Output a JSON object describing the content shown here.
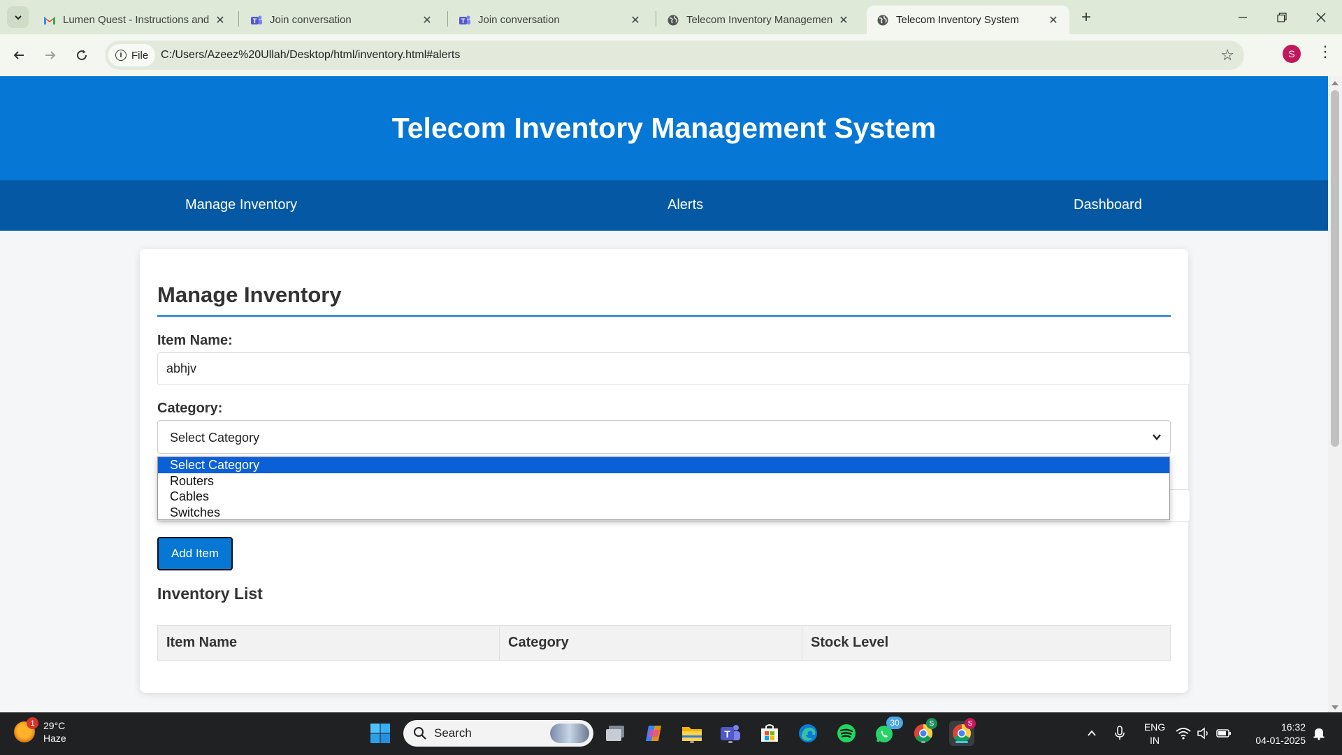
{
  "browser": {
    "tabs": [
      {
        "title": "Lumen Quest - Instructions and",
        "icon": "gmail-icon"
      },
      {
        "title": "Join conversation",
        "icon": "teams-icon"
      },
      {
        "title": "Join conversation",
        "icon": "teams-icon"
      },
      {
        "title": "Telecom Inventory Managemen",
        "icon": "globe-icon"
      },
      {
        "title": "Telecom Inventory System",
        "icon": "globe-icon",
        "active": true
      }
    ],
    "file_chip": "File",
    "url": "C:/Users/Azeez%20Ullah/Desktop/html/inventory.html#alerts",
    "profile_initial": "S"
  },
  "page": {
    "header_title": "Telecom Inventory Management System",
    "nav": [
      "Manage Inventory",
      "Alerts",
      "Dashboard"
    ],
    "section_title": "Manage Inventory",
    "item_name_label": "Item Name:",
    "item_name_value": "abhjv",
    "category_label": "Category:",
    "category_selected": "Select Category",
    "category_options": [
      "Select Category",
      "Routers",
      "Cables",
      "Switches"
    ],
    "add_button": "Add Item",
    "list_title": "Inventory List",
    "table_headers": [
      "Item Name",
      "Category",
      "Stock Level"
    ],
    "accent_color": "#0677d4",
    "nav_color": "#0458a4"
  },
  "taskbar": {
    "weather_temp": "29°C",
    "weather_desc": "Haze",
    "weather_badge": "1",
    "search_placeholder": "Search",
    "whatsapp_badge": "30",
    "lang_line1": "ENG",
    "lang_line2": "IN",
    "time": "16:32",
    "date": "04-01-2025"
  }
}
